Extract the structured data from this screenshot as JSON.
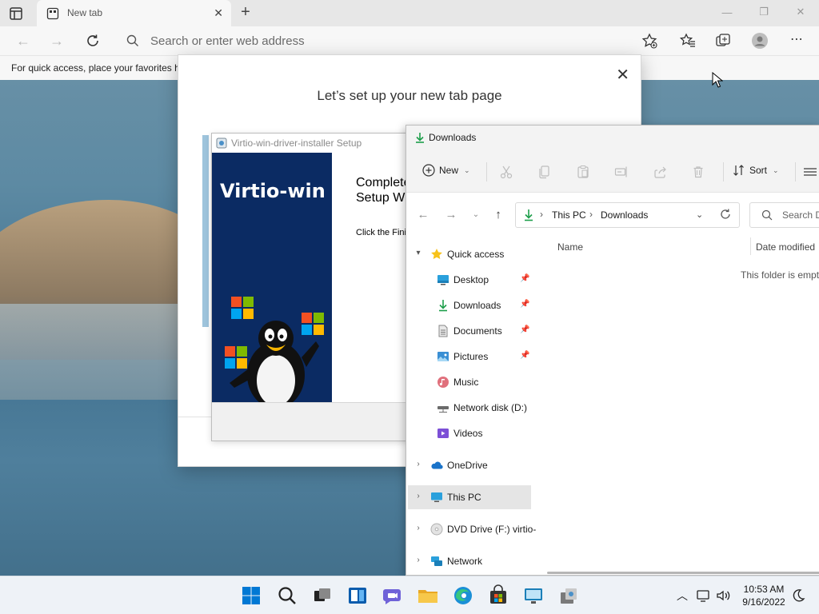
{
  "browser": {
    "tab_title": "New tab",
    "address_placeholder": "Search or enter web address",
    "favorites_bar_message": "For quick access, place your favorites h"
  },
  "ntp_dialog": {
    "title": "Let’s set up your new tab page"
  },
  "setup_window": {
    "title": "Virtio-win-driver-installer Setup",
    "brand": "Virtio-win",
    "heading_line1": "Complete",
    "heading_line2": "Setup Wi",
    "body": "Click the Finis"
  },
  "explorer": {
    "title": "Downloads",
    "commands": {
      "new": "New",
      "sort": "Sort"
    },
    "breadcrumb": [
      "This PC",
      "Downloads"
    ],
    "search_placeholder": "Search D",
    "nav": [
      {
        "label": "Quick access",
        "icon": "star-icon",
        "expanded": true,
        "level": 0
      },
      {
        "label": "Desktop",
        "icon": "desktop-icon",
        "pinned": true,
        "level": 1
      },
      {
        "label": "Downloads",
        "icon": "download-icon",
        "pinned": true,
        "level": 1
      },
      {
        "label": "Documents",
        "icon": "document-icon",
        "pinned": true,
        "level": 1
      },
      {
        "label": "Pictures",
        "icon": "pictures-icon",
        "pinned": true,
        "level": 1
      },
      {
        "label": "Music",
        "icon": "music-icon",
        "level": 1
      },
      {
        "label": "Network disk (D:)",
        "icon": "network-drive-icon",
        "level": 1
      },
      {
        "label": "Videos",
        "icon": "videos-icon",
        "level": 1
      },
      {
        "label": "OneDrive",
        "icon": "onedrive-icon",
        "level": 0
      },
      {
        "label": "This PC",
        "icon": "this-pc-icon",
        "level": 0,
        "selected": true
      },
      {
        "label": "DVD Drive (F:) virtio-",
        "icon": "dvd-drive-icon",
        "level": 0
      },
      {
        "label": "Network",
        "icon": "network-icon",
        "level": 0
      }
    ],
    "columns": {
      "name": "Name",
      "date_modified": "Date modified"
    },
    "empty_message": "This folder is empty."
  },
  "taskbar": {
    "time": "10:53 AM",
    "date": "9/16/2022",
    "apps": [
      "start-icon",
      "search-icon",
      "task-view-icon",
      "widgets-icon",
      "chat-icon",
      "file-explorer-icon",
      "edge-icon",
      "store-icon",
      "remote-desktop-icon",
      "installer-icon"
    ]
  },
  "colors": {
    "accent": "#0067c0",
    "explorer_selection": "#e5e5e5",
    "setup_banner": "#0b2b63",
    "download_green": "#1c9e4a"
  }
}
